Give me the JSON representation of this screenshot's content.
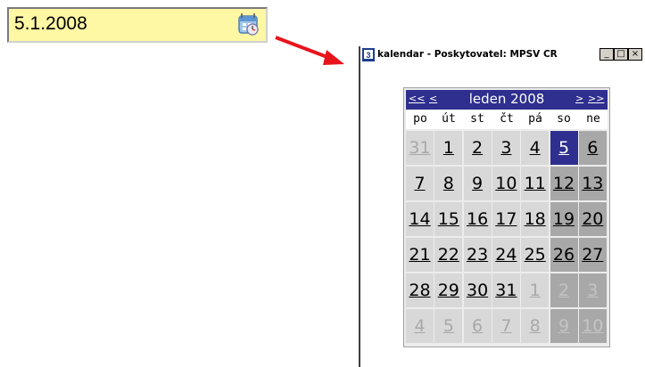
{
  "date_field": {
    "value": "5.1.2008",
    "calendar_button_icon": "calendar-icon"
  },
  "arrow": {
    "color": "#e8141c"
  },
  "window": {
    "title": "kalendar - Poskytovatel: MPSV CR",
    "buttons": {
      "minimize": "_",
      "maximize": "□",
      "close": "×"
    }
  },
  "calendar": {
    "nav_prev_year": "<<",
    "nav_prev_month": "<",
    "month_label": "leden 2008",
    "nav_next_month": ">",
    "nav_next_year": ">>",
    "weekdays": [
      "po",
      "út",
      "st",
      "čt",
      "pá",
      "so",
      "ne"
    ],
    "selected_day": "5",
    "weeks": [
      [
        {
          "d": "31",
          "t": "off"
        },
        {
          "d": "1",
          "t": "wk"
        },
        {
          "d": "2",
          "t": "wk"
        },
        {
          "d": "3",
          "t": "wk"
        },
        {
          "d": "4",
          "t": "wk"
        },
        {
          "d": "5",
          "t": "sel"
        },
        {
          "d": "6",
          "t": "we"
        }
      ],
      [
        {
          "d": "7",
          "t": "wk"
        },
        {
          "d": "8",
          "t": "wk"
        },
        {
          "d": "9",
          "t": "wk"
        },
        {
          "d": "10",
          "t": "wk"
        },
        {
          "d": "11",
          "t": "wk"
        },
        {
          "d": "12",
          "t": "we"
        },
        {
          "d": "13",
          "t": "we"
        }
      ],
      [
        {
          "d": "14",
          "t": "wk"
        },
        {
          "d": "15",
          "t": "wk"
        },
        {
          "d": "16",
          "t": "wk"
        },
        {
          "d": "17",
          "t": "wk"
        },
        {
          "d": "18",
          "t": "wk"
        },
        {
          "d": "19",
          "t": "we"
        },
        {
          "d": "20",
          "t": "we"
        }
      ],
      [
        {
          "d": "21",
          "t": "wk"
        },
        {
          "d": "22",
          "t": "wk"
        },
        {
          "d": "23",
          "t": "wk"
        },
        {
          "d": "24",
          "t": "wk"
        },
        {
          "d": "25",
          "t": "wk"
        },
        {
          "d": "26",
          "t": "we"
        },
        {
          "d": "27",
          "t": "we"
        }
      ],
      [
        {
          "d": "28",
          "t": "wk"
        },
        {
          "d": "29",
          "t": "wk"
        },
        {
          "d": "30",
          "t": "wk"
        },
        {
          "d": "31",
          "t": "wk"
        },
        {
          "d": "1",
          "t": "off"
        },
        {
          "d": "2",
          "t": "offwe"
        },
        {
          "d": "3",
          "t": "offwe"
        }
      ],
      [
        {
          "d": "4",
          "t": "off"
        },
        {
          "d": "5",
          "t": "off"
        },
        {
          "d": "6",
          "t": "off"
        },
        {
          "d": "7",
          "t": "off"
        },
        {
          "d": "8",
          "t": "off"
        },
        {
          "d": "9",
          "t": "offwe"
        },
        {
          "d": "10",
          "t": "offwe"
        }
      ]
    ]
  }
}
